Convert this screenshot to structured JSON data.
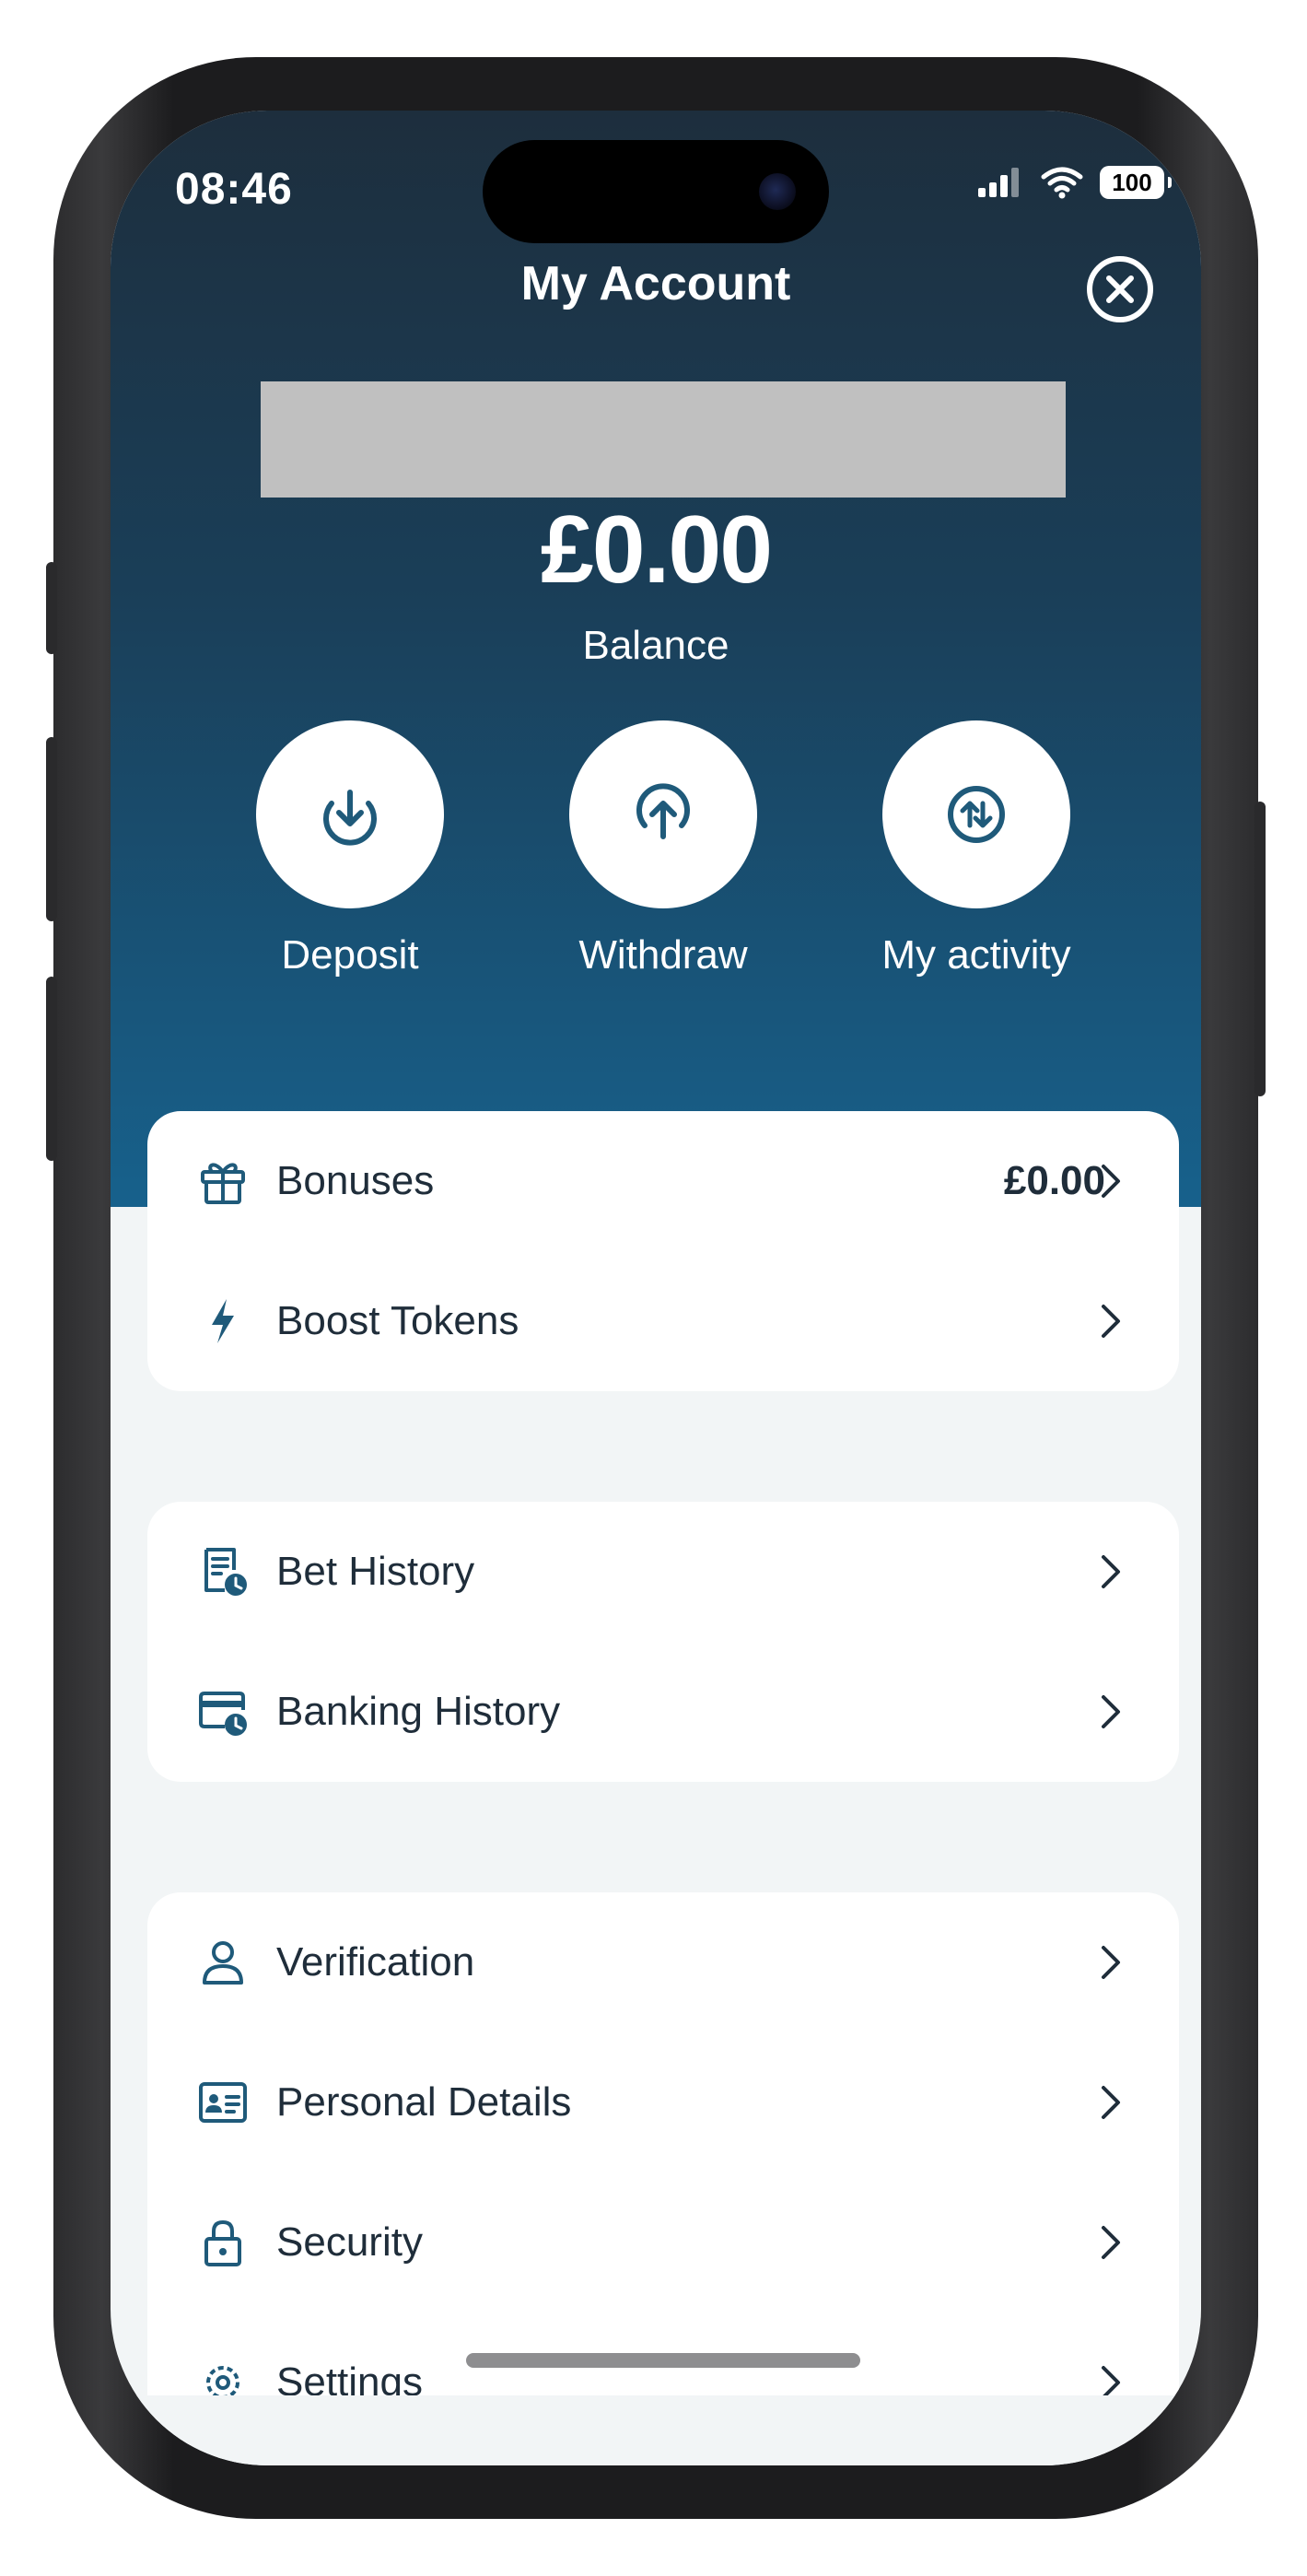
{
  "status_bar": {
    "time": "08:46",
    "battery": "100"
  },
  "header": {
    "title": "My Account"
  },
  "balance": {
    "amount": "£0.00",
    "label": "Balance"
  },
  "actions": [
    {
      "label": "Deposit",
      "icon": "download-arrow-icon"
    },
    {
      "label": "Withdraw",
      "icon": "upload-arrow-icon"
    },
    {
      "label": "My activity",
      "icon": "swap-arrows-icon"
    }
  ],
  "groups": [
    {
      "items": [
        {
          "label": "Bonuses",
          "value": "£0.00",
          "icon": "gift-icon"
        },
        {
          "label": "Boost Tokens",
          "icon": "lightning-icon"
        }
      ]
    },
    {
      "items": [
        {
          "label": "Bet History",
          "icon": "receipt-clock-icon"
        },
        {
          "label": "Banking History",
          "icon": "card-clock-icon"
        }
      ]
    },
    {
      "items": [
        {
          "label": "Verification",
          "icon": "person-icon"
        },
        {
          "label": "Personal Details",
          "icon": "id-card-icon"
        },
        {
          "label": "Security",
          "icon": "lock-icon"
        },
        {
          "label": "Settings",
          "icon": "gear-icon"
        }
      ]
    }
  ],
  "colors": {
    "header_top": "#1d2e3d",
    "header_bottom": "#17618c",
    "icon": "#1f5a7a",
    "text": "#1f2d3a",
    "page_bg": "#f2f5f6"
  }
}
